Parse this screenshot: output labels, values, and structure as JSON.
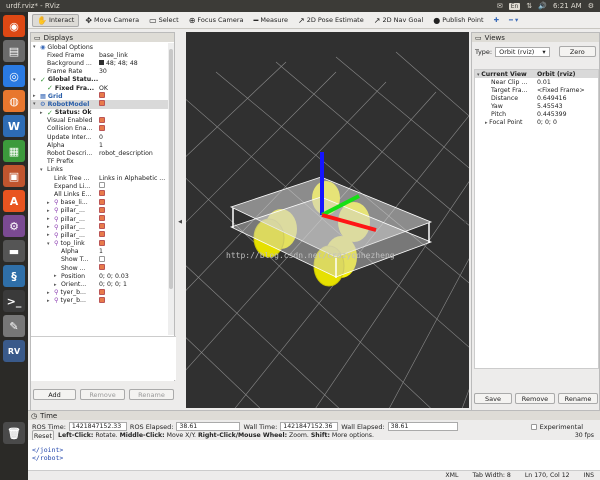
{
  "topbar": {
    "title": "urdf.rviz* - RViz",
    "lang": "En",
    "clock": "6:21 AM"
  },
  "toolbar": {
    "tools": [
      {
        "label": "Interact",
        "icon": "interact-icon",
        "glyph": "✋",
        "active": true
      },
      {
        "label": "Move Camera",
        "icon": "move-camera-icon",
        "glyph": "✥",
        "active": false
      },
      {
        "label": "Select",
        "icon": "select-icon",
        "glyph": "▭",
        "active": false
      },
      {
        "label": "Focus Camera",
        "icon": "focus-camera-icon",
        "glyph": "⊕",
        "active": false
      },
      {
        "label": "Measure",
        "icon": "measure-icon",
        "glyph": "━",
        "active": false
      },
      {
        "label": "2D Pose Estimate",
        "icon": "pose-estimate-icon",
        "glyph": "↗",
        "active": false
      },
      {
        "label": "2D Nav Goal",
        "icon": "nav-goal-icon",
        "glyph": "↗",
        "active": false
      },
      {
        "label": "Publish Point",
        "icon": "publish-point-icon",
        "glyph": "●",
        "active": false
      }
    ]
  },
  "displays": {
    "title": "Displays",
    "rows": [
      {
        "indent": 0,
        "arrow": "▾",
        "check": "",
        "icon": "globe",
        "key": "Global Options",
        "value": "",
        "keystyle": ""
      },
      {
        "indent": 1,
        "key": "Fixed Frame",
        "value": "base_link"
      },
      {
        "indent": 1,
        "key": "Background ...",
        "value": "48; 48; 48",
        "swatch": true
      },
      {
        "indent": 1,
        "key": "Frame Rate",
        "value": "30"
      },
      {
        "indent": 0,
        "arrow": "▾",
        "check": "✓",
        "key": "Global Statu...",
        "value": "",
        "keystyle": "bold"
      },
      {
        "indent": 1,
        "arrow": "",
        "check": "✓",
        "key": "Fixed Fra...",
        "value": "OK",
        "keystyle": "bold"
      },
      {
        "indent": 0,
        "arrow": "▸",
        "icon": "grid",
        "key": "Grid",
        "value": "",
        "cb": "on",
        "keystyle": "blue"
      },
      {
        "indent": 0,
        "arrow": "▾",
        "icon": "robot",
        "key": "RobotModel",
        "value": "",
        "cb": "on",
        "keystyle": "blue",
        "sel": true
      },
      {
        "indent": 1,
        "arrow": "▸",
        "check": "✓",
        "key": "Status: Ok",
        "value": "",
        "keystyle": "bold"
      },
      {
        "indent": 1,
        "key": "Visual Enabled",
        "value": "",
        "cb": "on"
      },
      {
        "indent": 1,
        "key": "Collision Ena...",
        "value": "",
        "cb": "on"
      },
      {
        "indent": 1,
        "key": "Update Inter...",
        "value": "0"
      },
      {
        "indent": 1,
        "key": "Alpha",
        "value": "1"
      },
      {
        "indent": 1,
        "key": "Robot Descri...",
        "value": "robot_description"
      },
      {
        "indent": 1,
        "key": "TF Prefix",
        "value": ""
      },
      {
        "indent": 1,
        "arrow": "▾",
        "key": "Links",
        "value": ""
      },
      {
        "indent": 2,
        "key": "Link Tree ...",
        "value": "Links in Alphabetic ..."
      },
      {
        "indent": 2,
        "key": "Expand Li...",
        "value": "",
        "cb": "off"
      },
      {
        "indent": 2,
        "key": "All Links E...",
        "value": "",
        "cb": "on"
      },
      {
        "indent": 2,
        "arrow": "▸",
        "link": true,
        "key": "base_li...",
        "value": "",
        "cb": "on"
      },
      {
        "indent": 2,
        "arrow": "▸",
        "link": true,
        "key": "pillar_...",
        "value": "",
        "cb": "on"
      },
      {
        "indent": 2,
        "arrow": "▸",
        "link": true,
        "key": "pillar_...",
        "value": "",
        "cb": "on"
      },
      {
        "indent": 2,
        "arrow": "▸",
        "link": true,
        "key": "pillar_...",
        "value": "",
        "cb": "on"
      },
      {
        "indent": 2,
        "arrow": "▸",
        "link": true,
        "key": "pillar_...",
        "value": "",
        "cb": "on"
      },
      {
        "indent": 2,
        "arrow": "▾",
        "link": true,
        "key": "top_link",
        "value": "",
        "cb": "on"
      },
      {
        "indent": 3,
        "key": "Alpha",
        "value": "1"
      },
      {
        "indent": 3,
        "key": "Show T...",
        "value": "",
        "cb": "off"
      },
      {
        "indent": 3,
        "key": "Show ...",
        "value": "",
        "cb": "on"
      },
      {
        "indent": 3,
        "arrow": "▸",
        "key": "Position",
        "value": "0; 0; 0.03"
      },
      {
        "indent": 3,
        "arrow": "▸",
        "key": "Orient...",
        "value": "0; 0; 0; 1"
      },
      {
        "indent": 2,
        "arrow": "▸",
        "link": true,
        "key": "tyer_b...",
        "value": "",
        "cb": "on"
      },
      {
        "indent": 2,
        "arrow": "▸",
        "link": true,
        "key": "tyer_b...",
        "value": "",
        "cb": "on"
      }
    ],
    "buttons": {
      "add": "Add",
      "remove": "Remove",
      "rename": "Rename"
    }
  },
  "views": {
    "title": "Views",
    "type_label": "Type:",
    "type_value": "Orbit (rviz)",
    "zero": "Zero",
    "rows": [
      {
        "key": "Current View",
        "value": "Orbit (rviz)",
        "head": true,
        "arrow": "▾"
      },
      {
        "key": "Near Clip ...",
        "value": "0.01"
      },
      {
        "key": "Target Fra...",
        "value": "<Fixed Frame>"
      },
      {
        "key": "Distance",
        "value": "0.649416"
      },
      {
        "key": "Yaw",
        "value": "5.45543"
      },
      {
        "key": "Pitch",
        "value": "0.445399"
      },
      {
        "key": "Focal Point",
        "value": "0; 0; 0",
        "arrow": "▸"
      }
    ],
    "buttons": {
      "save": "Save",
      "remove": "Remove",
      "rename": "Rename"
    }
  },
  "time": {
    "title": "Time",
    "ros_time_label": "ROS Time:",
    "ros_time": "1421847152.33",
    "ros_elapsed_label": "ROS Elapsed:",
    "ros_elapsed": "38.61",
    "wall_time_label": "Wall Time:",
    "wall_time": "1421847152.36",
    "wall_elapsed_label": "Wall Elapsed:",
    "wall_elapsed": "38.61",
    "experimental": "Experimental"
  },
  "help": {
    "reset": "Reset",
    "t1": "Left-Click:",
    "t2": " Rotate. ",
    "t3": "Middle-Click:",
    "t4": " Move X/Y. ",
    "t5": "Right-Click/Mouse Wheel:",
    "t6": " Zoom. ",
    "t7": "Shift:",
    "t8": " More options.",
    "fps": "30 fps"
  },
  "watermark": "http://blog.csdn.net/crazyquhezheng",
  "editor": {
    "lines": [
      "  </joint>",
      "</robot>"
    ]
  },
  "statusbar": {
    "lang": "XML",
    "tab": "Tab Width: 8",
    "pos": "Ln 170, Col 12",
    "mode": "INS"
  }
}
